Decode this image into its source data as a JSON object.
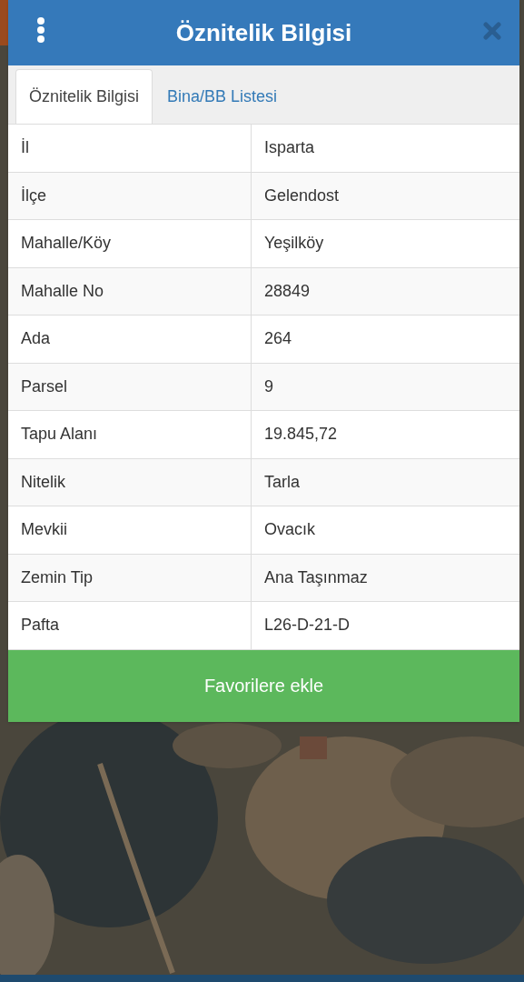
{
  "dialog": {
    "title": "Öznitelik Bilgisi"
  },
  "tabs": [
    {
      "label": "Öznitelik Bilgisi",
      "selected": true
    },
    {
      "label": "Bina/BB Listesi",
      "selected": false
    }
  ],
  "table": {
    "rows": [
      {
        "label": "İl",
        "value": "Isparta"
      },
      {
        "label": "İlçe",
        "value": "Gelendost"
      },
      {
        "label": "Mahalle/Köy",
        "value": "Yeşilköy"
      },
      {
        "label": "Mahalle No",
        "value": "28849"
      },
      {
        "label": "Ada",
        "value": "264"
      },
      {
        "label": "Parsel",
        "value": "9"
      },
      {
        "label": "Tapu Alanı",
        "value": "19.845,72"
      },
      {
        "label": "Nitelik",
        "value": "Tarla"
      },
      {
        "label": "Mevkii",
        "value": "Ovacık"
      },
      {
        "label": "Zemin Tip",
        "value": "Ana Taşınmaz"
      },
      {
        "label": "Pafta",
        "value": "L26-D-21-D"
      }
    ]
  },
  "button": {
    "label": "Favorilere ekle"
  }
}
